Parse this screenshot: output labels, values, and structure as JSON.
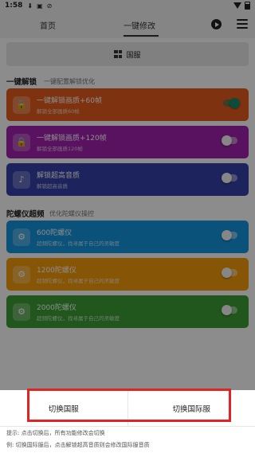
{
  "status": {
    "time": "1:58"
  },
  "appbar": {
    "tabs": [
      {
        "label": "首页"
      },
      {
        "label": "一键修改"
      }
    ]
  },
  "server_button": {
    "label": "国服"
  },
  "section1": {
    "title": "一键解锁",
    "subtitle": "一键配置解锁优化"
  },
  "cards1": [
    {
      "title": "一键解锁画质+60帧",
      "desc": "解锁全部画质60帧",
      "color": "#e65c1c",
      "icon": "lock-icon",
      "on": true
    },
    {
      "title": "一键解锁画质+120帧",
      "desc": "解锁全部画质120帧",
      "color": "#a021ae",
      "icon": "lock-icon",
      "on": false
    },
    {
      "title": "解锁超高音质",
      "desc": "解锁超高音质",
      "color": "#3640aa",
      "icon": "music-note-icon",
      "on": false
    }
  ],
  "section2": {
    "title": "陀螺仪超频",
    "subtitle": "优化陀螺仪操控"
  },
  "cards2": [
    {
      "title": "600陀螺仪",
      "desc": "超频陀螺仪，找寻属于自己的灵敏度",
      "color": "#1496df",
      "icon": "gear-icon",
      "on": false
    },
    {
      "title": "1200陀螺仪",
      "desc": "超频陀螺仪，找寻属于自己的灵敏度",
      "color": "#f59c0c",
      "icon": "gear-icon",
      "on": false
    },
    {
      "title": "2000陀螺仪",
      "desc": "超频陀螺仪，找寻属于自己的灵敏度",
      "color": "#3d9e35",
      "icon": "gear-icon",
      "on": false
    }
  ],
  "sheet": {
    "btn_cn": "切换国服",
    "btn_intl": "切换国际服",
    "hint1": "提示: 点击切换后，所有功能修改会切换",
    "hint2": "例: 切换国际服后，点击解锁超高音质则会修改国际服音质"
  }
}
